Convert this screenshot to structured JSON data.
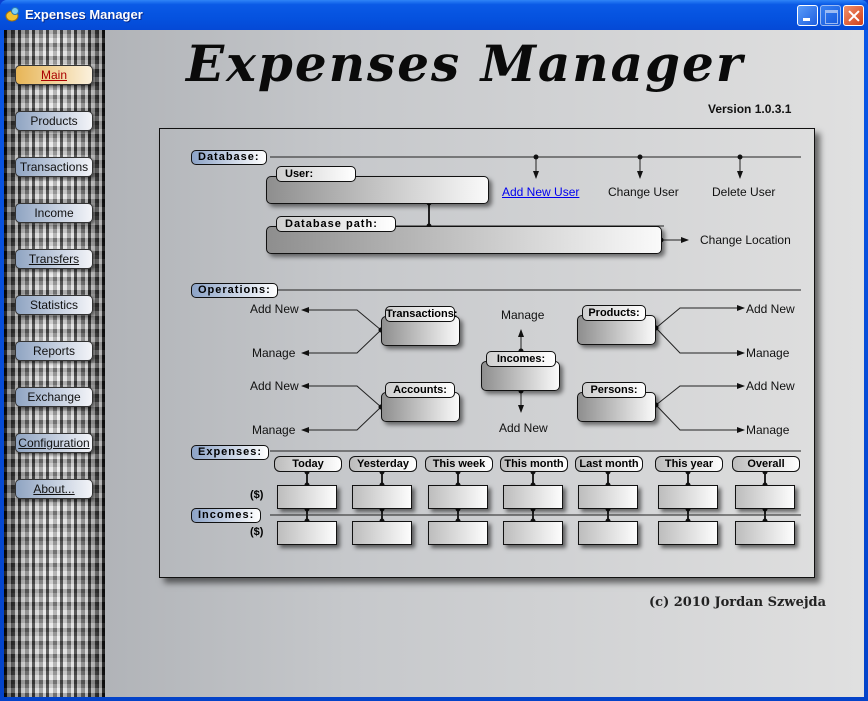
{
  "window": {
    "title": "Expenses Manager",
    "controls": [
      "minimize",
      "maximize",
      "close"
    ]
  },
  "sidebar": {
    "items": [
      {
        "label": "Main",
        "active": true
      },
      {
        "label": "Products"
      },
      {
        "label": "Transactions"
      },
      {
        "label": "Income"
      },
      {
        "label": "Transfers"
      },
      {
        "label": "Statistics"
      },
      {
        "label": "Reports"
      },
      {
        "label": "Exchange"
      },
      {
        "label": "Configuration"
      },
      {
        "label": "About..."
      }
    ]
  },
  "header": {
    "logo": "Expenses Manager",
    "version": "Version 1.0.3.1"
  },
  "database": {
    "label": "Database:",
    "user_label": "User:",
    "user_value": "",
    "path_label": "Database path:",
    "path_value": "",
    "add_new_user": "Add New User",
    "change_user": "Change User",
    "delete_user": "Delete User",
    "change_location": "Change Location"
  },
  "operations": {
    "label": "Operations:",
    "transactions": {
      "label": "Transactions:",
      "add_new": "Add New",
      "manage": "Manage"
    },
    "accounts": {
      "label": "Accounts:",
      "add_new": "Add New",
      "manage": "Manage"
    },
    "incomes": {
      "label": "Incomes:",
      "add_new": "Add New",
      "manage": "Manage"
    },
    "products": {
      "label": "Products:",
      "add_new": "Add New",
      "manage": "Manage"
    },
    "persons": {
      "label": "Persons:",
      "add_new": "Add New",
      "manage": "Manage"
    }
  },
  "summary": {
    "expenses_label": "Expenses:",
    "incomes_label": "Incomes:",
    "currency": "($)",
    "periods": [
      "Today",
      "Yesterday",
      "This week",
      "This month",
      "Last month",
      "This year",
      "Overall"
    ],
    "expenses_values": [
      "",
      "",
      "",
      "",
      "",
      "",
      ""
    ],
    "incomes_values": [
      "",
      "",
      "",
      "",
      "",
      "",
      ""
    ]
  },
  "footer": {
    "copyright": "(c) 2010 Jordan Szwejda"
  }
}
